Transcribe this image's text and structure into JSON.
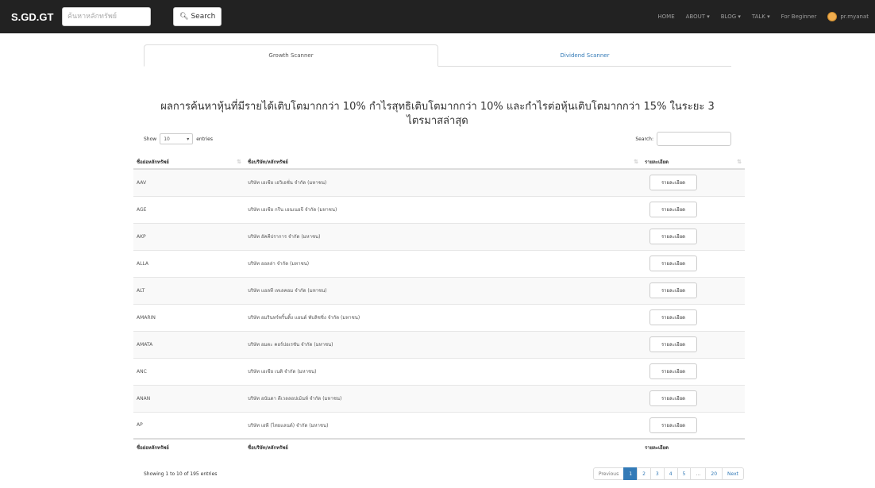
{
  "navbar": {
    "brand": "S.GD.GT",
    "search_placeholder": "ค้นหาหลักทรัพย์",
    "search_button": "Search",
    "links": [
      "HOME",
      "ABOUT ▾",
      "BLOG ▾",
      "TALK ▾",
      "For Beginner"
    ],
    "user": "pr.myanat"
  },
  "tabs": [
    {
      "label": "Growth Scanner",
      "active": true
    },
    {
      "label": "Dividend Scanner",
      "active": false
    }
  ],
  "heading": "ผลการค้นหาหุ้นที่มีรายได้เติบโตมากกว่า 10% กำไรสุทธิเติบโตมากกว่า 10% และกำไรต่อหุ้นเติบโตมากกว่า 15% ในระยะ 3 ไตรมาสล่าสุด",
  "controls": {
    "show_label": "Show",
    "length_value": "10",
    "entries_label": "entries",
    "search_label": "Search:"
  },
  "table": {
    "columns": [
      "ชื่อย่อหลักทรัพย์",
      "ชื่อบริษัท/หลักทรัพย์",
      "รายละเอียด"
    ],
    "rows": [
      {
        "symbol": "AAV",
        "name": "บริษัท เอเชีย เอวิเอชั่น จำกัด (มหาชน)",
        "action": "รายละเอียด"
      },
      {
        "symbol": "AGE",
        "name": "บริษัท เอเชีย กรีน เอนเนอจี จำกัด (มหาชน)",
        "action": "รายละเอียด"
      },
      {
        "symbol": "AKP",
        "name": "บริษัท อัคคีปราการ จำกัด (มหาชน)",
        "action": "รายละเอียด"
      },
      {
        "symbol": "ALLA",
        "name": "บริษัท ออลล่า จำกัด (มหาชน)",
        "action": "รายละเอียด"
      },
      {
        "symbol": "ALT",
        "name": "บริษัท แอลที เทเลคอม จำกัด (มหาชน)",
        "action": "รายละเอียด"
      },
      {
        "symbol": "AMARIN",
        "name": "บริษัท อมรินทร์พริ้นติ้ง แอนด์ พับลิชชิ่ง จำกัด (มหาชน)",
        "action": "รายละเอียด"
      },
      {
        "symbol": "AMATA",
        "name": "บริษัท อมตะ คอร์ปอเรชัน จำกัด (มหาชน)",
        "action": "รายละเอียด"
      },
      {
        "symbol": "ANC",
        "name": "บริษัท เอเชีย เนติ จำกัด (มหาชน)",
        "action": "รายละเอียด"
      },
      {
        "symbol": "ANAN",
        "name": "บริษัท อนันดา ดีเวลลอปเม้นท์ จำกัด (มหาชน)",
        "action": "รายละเอียด"
      },
      {
        "symbol": "AP",
        "name": "บริษัท เอพี (ไทยแลนด์) จำกัด (มหาชน)",
        "action": "รายละเอียด"
      }
    ]
  },
  "footer": {
    "info": "Showing 1 to 10 of 195 entries",
    "pager": [
      "Previous",
      "1",
      "2",
      "3",
      "4",
      "5",
      "…",
      "20",
      "Next"
    ],
    "current_page": "1"
  },
  "colors": {
    "navbar_bg": "#222222",
    "link": "#337ab7",
    "pager_active": "#337ab7"
  }
}
